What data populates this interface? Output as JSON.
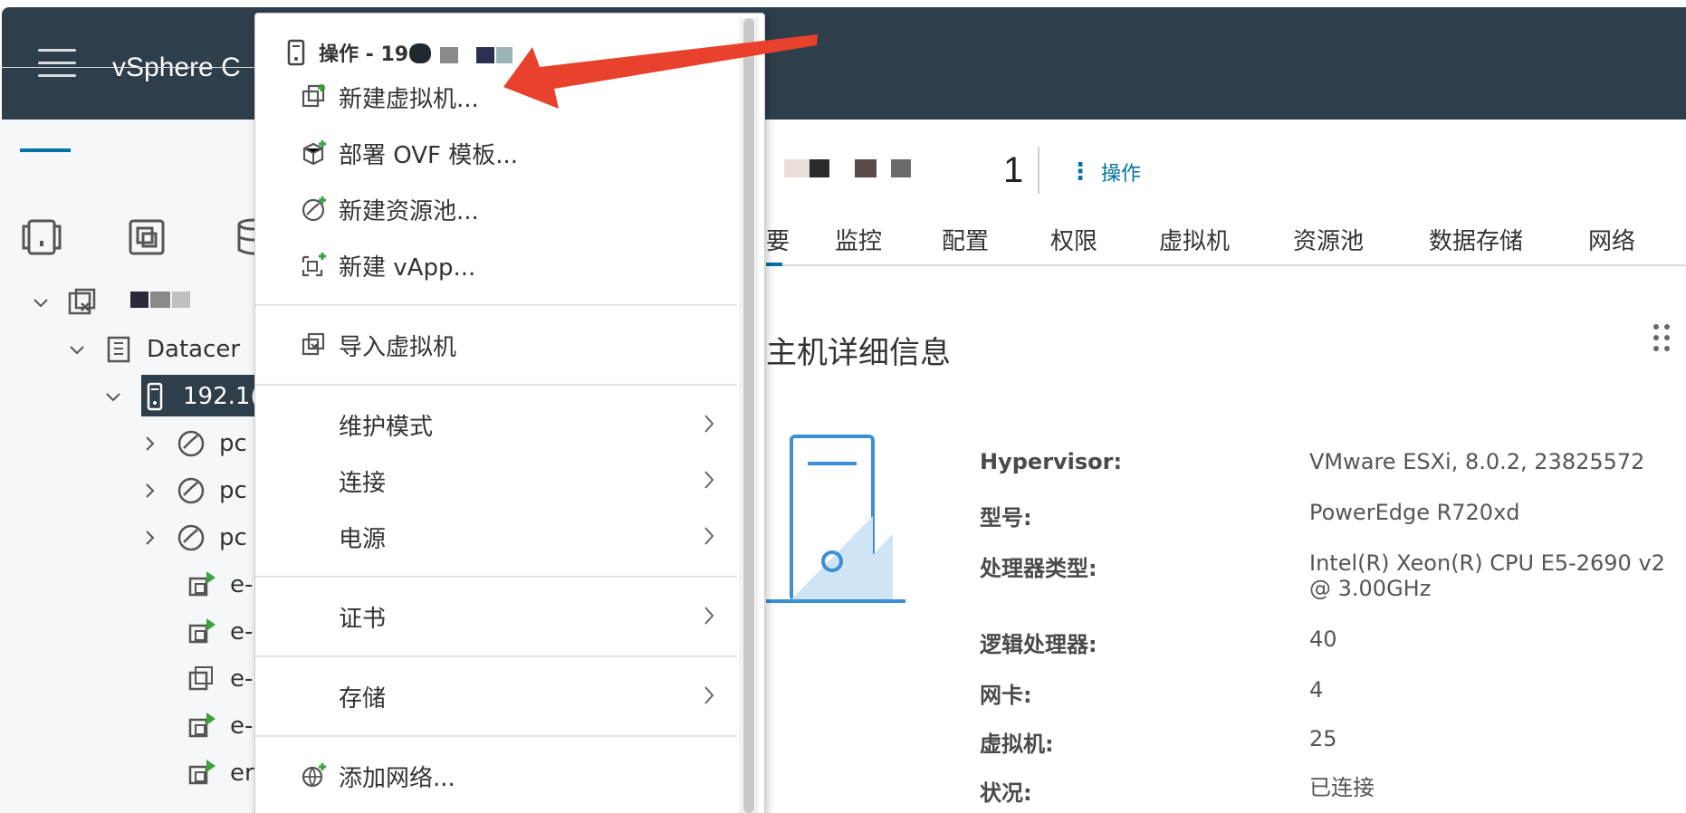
{
  "app": {
    "title": "vSphere C"
  },
  "tree": {
    "items": [
      {
        "label": ""
      },
      {
        "label": "Datacer"
      },
      {
        "label": "192.1("
      },
      {
        "label": "pc"
      },
      {
        "label": "pc"
      },
      {
        "label": "pc"
      },
      {
        "label": "e-"
      },
      {
        "label": "e-"
      },
      {
        "label": "e-"
      },
      {
        "label": "e-"
      },
      {
        "label": "er"
      }
    ]
  },
  "header": {
    "host_name": "1",
    "actions_label": "操作"
  },
  "tabs": {
    "partial": "要",
    "items": [
      {
        "label": "监控"
      },
      {
        "label": "配置"
      },
      {
        "label": "权限"
      },
      {
        "label": "虚拟机"
      },
      {
        "label": "资源池"
      },
      {
        "label": "数据存储"
      },
      {
        "label": "网络"
      }
    ]
  },
  "card": {
    "title": "主机详细信息",
    "rows": [
      {
        "label": "Hypervisor:",
        "value": "VMware ESXi, 8.0.2, 23825572"
      },
      {
        "label": "型号:",
        "value": "PowerEdge R720xd"
      },
      {
        "label": "处理器类型:",
        "value": "Intel(R) Xeon(R) CPU E5-2690 v2 @ 3.00GHz"
      },
      {
        "label": "逻辑处理器:",
        "value": "40"
      },
      {
        "label": "网卡:",
        "value": "4"
      },
      {
        "label": "虚拟机:",
        "value": "25"
      },
      {
        "label": "状况:",
        "value": "已连接"
      }
    ]
  },
  "context_menu": {
    "header": "操作 - 19",
    "items": [
      {
        "label": "新建虚拟机..."
      },
      {
        "label": "部署 OVF 模板..."
      },
      {
        "label": "新建资源池..."
      },
      {
        "label": "新建 vApp..."
      },
      {
        "label": "导入虚拟机"
      },
      {
        "label": "维护模式"
      },
      {
        "label": "连接"
      },
      {
        "label": "电源"
      },
      {
        "label": "证书"
      },
      {
        "label": "存储"
      },
      {
        "label": "添加网络..."
      }
    ]
  },
  "colors": {
    "header_bg": "#2f3e4b",
    "accent": "#0072a3",
    "annotation_arrow": "#e8412c"
  }
}
